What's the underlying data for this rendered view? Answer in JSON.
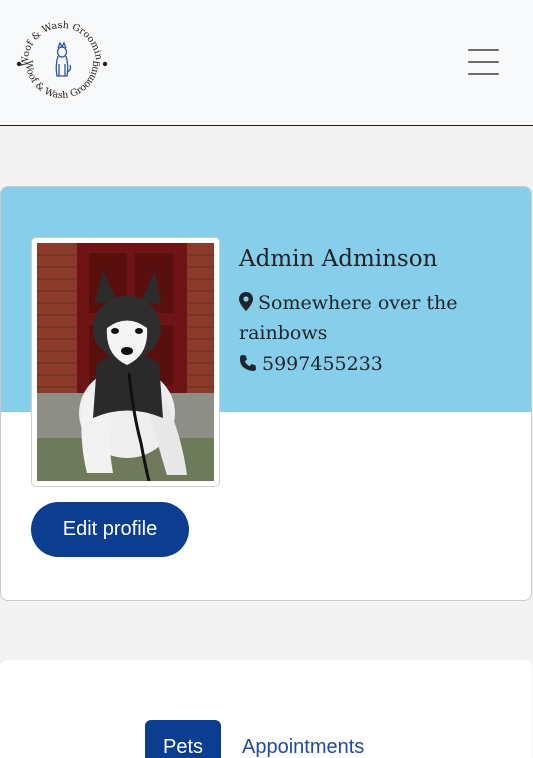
{
  "brand": {
    "logo_text": "Woof & Wash Grooming"
  },
  "navbar": {
    "menu_icon": "hamburger-icon"
  },
  "profile": {
    "name": "Admin Adminson",
    "location": "Somewhere over the rainbows",
    "location_icon": "map-pin-icon",
    "phone": "5997455233",
    "phone_icon": "phone-icon",
    "photo_alt": "Husky dog photo",
    "edit_button": "Edit profile",
    "banner_color": "#87ceeb",
    "accent_color": "#0b3d91"
  },
  "tabs": [
    {
      "label": "Pets",
      "active": true
    },
    {
      "label": "Appointments",
      "active": false
    }
  ]
}
